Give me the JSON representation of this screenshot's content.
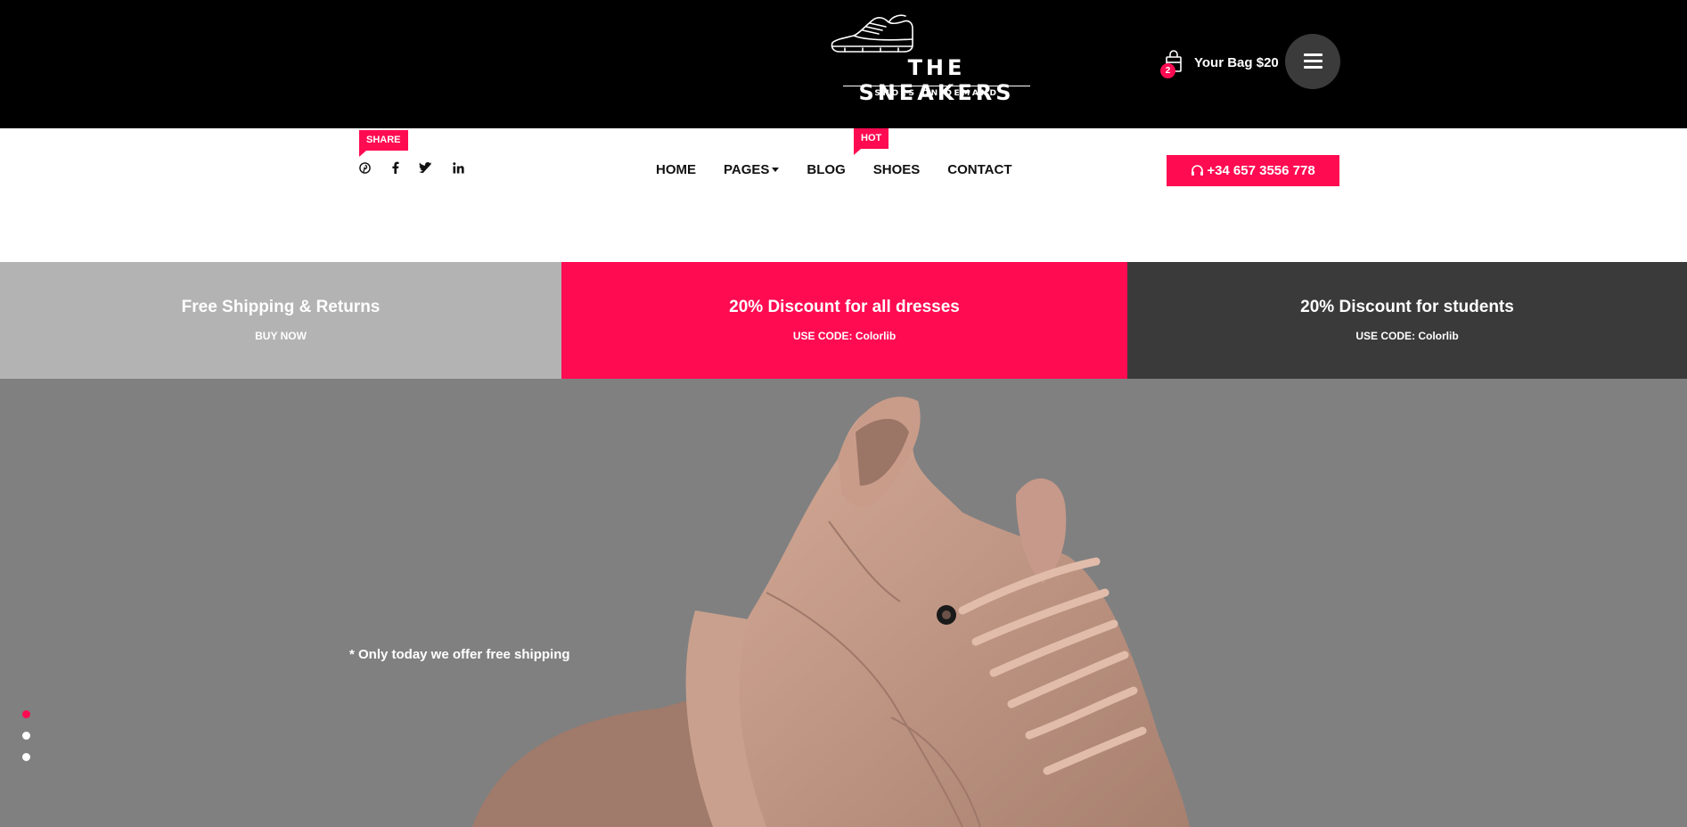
{
  "brand": {
    "title": "THE SNEAKERS",
    "tagline": "SHOES ON DEMAND"
  },
  "cart": {
    "count": "2",
    "label": "Your Bag $20",
    "icon": "shopping-bag-icon"
  },
  "menu": {
    "icon": "hamburger-menu-icon"
  },
  "share": {
    "tag": "SHARE",
    "icons": [
      "pinterest-icon",
      "facebook-icon",
      "twitter-icon",
      "linkedin-icon"
    ]
  },
  "nav": {
    "hot_tag": "HOT",
    "items": [
      "HOME",
      "PAGES",
      "BLOG",
      "SHOES",
      "CONTACT"
    ]
  },
  "phone": {
    "label": "+34 657 3556 778",
    "icon": "headset-icon"
  },
  "promos": [
    {
      "title": "Free Shipping & Returns",
      "sub": "BUY NOW"
    },
    {
      "title": "20% Discount for all dresses",
      "sub": "USE CODE: Colorlib"
    },
    {
      "title": "20% Discount for students",
      "sub": "USE CODE: Colorlib"
    }
  ],
  "hero": {
    "note": "* Only today we offer free shipping",
    "slides": 3,
    "active_slide": 1
  },
  "colors": {
    "accent": "#ff0b52",
    "header": "#000000",
    "dark": "#3a3a3a",
    "grey": "#b3b3b3",
    "hero_bg": "#808080"
  }
}
